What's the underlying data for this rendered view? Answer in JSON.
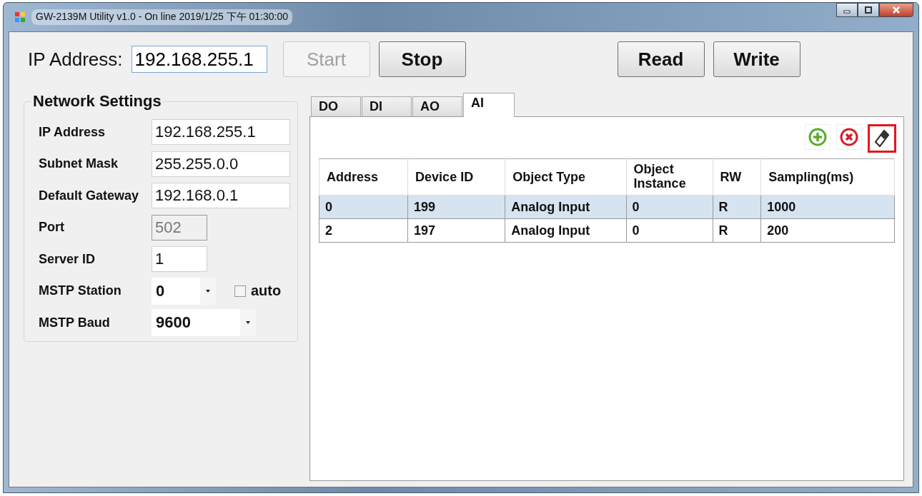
{
  "window": {
    "title": "GW-2139M Utility v1.0 - On line 2019/1/25 下午 01:30:00"
  },
  "toolbar": {
    "ip_label": "IP Address:",
    "ip_value": "192.168.255.1",
    "buttons": [
      {
        "label": "Start",
        "disabled": true
      },
      {
        "label": "Stop",
        "disabled": false
      },
      {
        "label": "Read",
        "disabled": false
      },
      {
        "label": "Write",
        "disabled": false
      }
    ]
  },
  "network_settings": {
    "title": "Network Settings",
    "fields": [
      {
        "label": "IP Address",
        "kind": "text",
        "value": "192.168.255.1",
        "disabled": false
      },
      {
        "label": "Subnet Mask",
        "kind": "text",
        "value": "255.255.0.0",
        "disabled": false
      },
      {
        "label": "Default Gateway",
        "kind": "text",
        "value": "192.168.0.1",
        "disabled": false
      },
      {
        "label": "Port",
        "kind": "number",
        "value": "502",
        "disabled": true
      },
      {
        "label": "Server ID",
        "kind": "number",
        "value": "1",
        "disabled": false
      },
      {
        "label": "MSTP Station",
        "kind": "dropdown",
        "value": "0",
        "disabled": false,
        "checkbox": {
          "label": "auto",
          "checked": false
        }
      },
      {
        "label": "MSTP Baud",
        "kind": "dropdown",
        "value": "9600",
        "disabled": false
      }
    ]
  },
  "tabs": [
    {
      "label": "DO",
      "selected": false
    },
    {
      "label": "DI",
      "selected": false
    },
    {
      "label": "AO",
      "selected": false
    },
    {
      "label": "AI",
      "selected": true
    }
  ],
  "tools": [
    {
      "kind": "add",
      "selected": false
    },
    {
      "kind": "delete",
      "selected": false
    },
    {
      "kind": "eraser",
      "selected": true
    }
  ],
  "table": {
    "columns": [
      "Address",
      "Device ID",
      "Object Type",
      "Object Instance",
      "RW",
      "Sampling(ms)"
    ],
    "rows": [
      {
        "cells": [
          "0",
          "199",
          "Analog Input",
          "0",
          "R",
          "1000"
        ],
        "selected": true
      },
      {
        "cells": [
          "2",
          "197",
          "Analog Input",
          "0",
          "R",
          "200"
        ],
        "selected": false
      }
    ]
  }
}
